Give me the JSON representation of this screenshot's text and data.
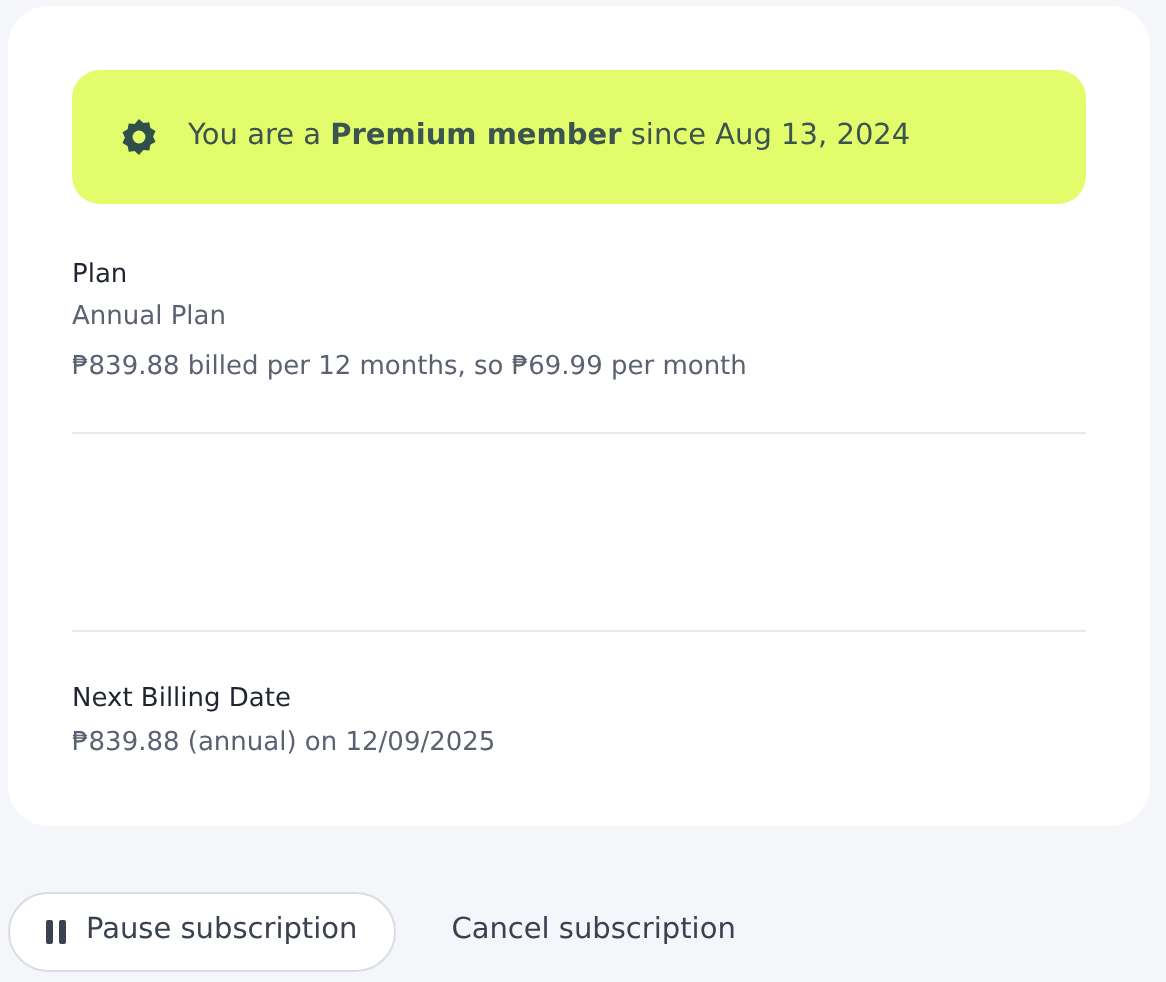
{
  "banner": {
    "text": "You are a **Premium member** since Aug 13, 2024"
  },
  "plan": {
    "label": "Plan",
    "name": "Annual Plan",
    "price": "₱839.88 billed per 12 months, so ₱69.99 per month"
  },
  "next_billing": {
    "label": "Next Billing Date",
    "value": "₱839.88 (annual) on 12/09/2025"
  },
  "actions": [
    {
      "kind": "outlined",
      "label": "Pause subscription"
    },
    {
      "kind": "text",
      "label": "Cancel subscription"
    }
  ]
}
